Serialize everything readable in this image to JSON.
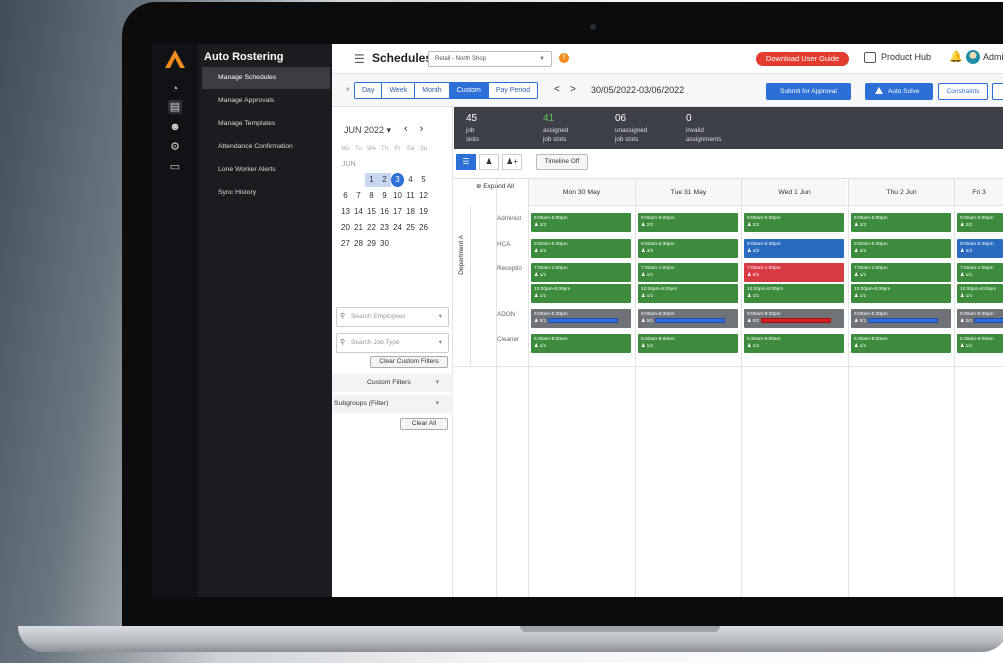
{
  "nav": {
    "title": "Auto Rostering",
    "items": [
      {
        "label": "Manage Schedules",
        "active": true
      },
      {
        "label": "Manage Approvals",
        "active": false
      },
      {
        "label": "Manage Templates",
        "active": false
      },
      {
        "label": "Attendance Confirmation",
        "active": false
      },
      {
        "label": "Lone Worker Alerts",
        "active": false
      },
      {
        "label": "Sync History",
        "active": false
      }
    ]
  },
  "rail": {
    "icons": [
      "gauge-icon",
      "calendar-icon",
      "users-icon",
      "gear-icon",
      "folder-icon"
    ]
  },
  "header": {
    "title": "Schedules",
    "shop_select": "Retail - North Shop",
    "guide_button": "Download User Guide",
    "product_hub": "Product Hub",
    "user_label": "Admin"
  },
  "toolbar": {
    "collapse": "«",
    "views": [
      {
        "label": "Day",
        "active": false
      },
      {
        "label": "Week",
        "active": false
      },
      {
        "label": "Month",
        "active": false
      },
      {
        "label": "Custom",
        "active": true
      },
      {
        "label": "Pay Period",
        "active": false
      }
    ],
    "prev": "<",
    "next": ">",
    "range": "30/05/2022-03/06/2022",
    "submit": "Submit for Approval",
    "auto_solve": "Auto Solve",
    "constraints": "Constraints"
  },
  "calendar": {
    "month": "JUN 2022",
    "dow": [
      "Mo",
      "Tu",
      "We",
      "Th",
      "Fr",
      "Sa",
      "Su"
    ],
    "sub_label": "JUN",
    "weeks": [
      [
        "",
        "",
        "1",
        "2",
        "3",
        "4",
        "5"
      ],
      [
        "6",
        "7",
        "8",
        "9",
        "10",
        "11",
        "12"
      ],
      [
        "13",
        "14",
        "15",
        "16",
        "17",
        "18",
        "19"
      ],
      [
        "20",
        "21",
        "22",
        "23",
        "24",
        "25",
        "26"
      ],
      [
        "27",
        "28",
        "29",
        "30",
        "",
        "",
        ""
      ]
    ]
  },
  "filters": {
    "employees_placeholder": "Search Employees",
    "jobtype_placeholder": "Search Job Type",
    "clear_custom": "Clear Custom Filters",
    "custom_filters": "Custom Filters",
    "subgroups": "Subgroups (Filter)",
    "clear_all": "Clear All"
  },
  "stats": [
    {
      "num": "45",
      "lines": [
        "job",
        "slots"
      ]
    },
    {
      "num": "41",
      "lines": [
        "assigned",
        "job slots"
      ]
    },
    {
      "num": "06",
      "lines": [
        "unassigned",
        "job slots"
      ]
    },
    {
      "num": "0",
      "lines": [
        "invalid",
        "assignments"
      ]
    }
  ],
  "grid_controls": {
    "timeline": "Timeline Off"
  },
  "grid": {
    "expand_all": "Expand All",
    "department": "Department A",
    "days": [
      "Mon 30 May",
      "Tue 31 May",
      "Wed 1 Jun",
      "Thu 2 Jun",
      "Fri 3"
    ],
    "rows": [
      {
        "role": "Administ",
        "shifts": [
          {
            "time": "9:00am-5:00pm",
            "count": "2/2",
            "color": "green"
          },
          {
            "time": "9:00am-5:00pm",
            "count": "2/2",
            "color": "green"
          },
          {
            "time": "9:00am-5:00pm",
            "count": "2/2",
            "color": "green"
          },
          {
            "time": "9:00am-5:00pm",
            "count": "2/2",
            "color": "green"
          },
          {
            "time": "9:00am-5:00pm",
            "count": "2/2",
            "color": "green"
          }
        ]
      },
      {
        "role": "HCA",
        "shifts": [
          {
            "time": "9:00am-5:30pm",
            "count": "3/3",
            "color": "green"
          },
          {
            "time": "9:00am-5:30pm",
            "count": "3/3",
            "color": "green"
          },
          {
            "time": "9:00am-5:30pm",
            "count": "4/3",
            "color": "blue"
          },
          {
            "time": "9:00am-5:30pm",
            "count": "3/3",
            "color": "green"
          },
          {
            "time": "9:00am-5:30pm",
            "count": "4/3",
            "color": "blue"
          }
        ]
      },
      {
        "role": "Receptio",
        "shifts": [
          {
            "time": "7:00am-1:00pm",
            "count": "1/1",
            "color": "green"
          },
          {
            "time": "7:00am-1:00pm",
            "count": "1/1",
            "color": "green"
          },
          {
            "time": "7:00am-1:00pm",
            "count": "0/1",
            "color": "red"
          },
          {
            "time": "7:00am-1:00pm",
            "count": "1/1",
            "color": "green"
          },
          {
            "time": "7:00am-1:00pm",
            "count": "1/1",
            "color": "green"
          }
        ]
      },
      {
        "role": "",
        "shifts": [
          {
            "time": "12:00pm-8:00pm",
            "count": "1/1",
            "color": "green"
          },
          {
            "time": "12:00pm-8:00pm",
            "count": "1/1",
            "color": "green"
          },
          {
            "time": "12:00pm-8:00pm",
            "count": "1/1",
            "color": "green"
          },
          {
            "time": "12:00pm-8:00pm",
            "count": "1/1",
            "color": "green"
          },
          {
            "time": "12:00pm-8:00pm",
            "count": "1/1",
            "color": "green"
          }
        ]
      },
      {
        "role": "ADON",
        "shifts": [
          {
            "time": "9:00am-5:30pm",
            "count": "0/1",
            "color": "grey",
            "bar": "blue"
          },
          {
            "time": "9:00am-5:30pm",
            "count": "0/1",
            "color": "grey",
            "bar": "blue"
          },
          {
            "time": "9:00am-8:30pm",
            "count": "0/1",
            "color": "grey",
            "bar": "red"
          },
          {
            "time": "9:00am-5:30pm",
            "count": "0/1",
            "color": "grey",
            "bar": "blue"
          },
          {
            "time": "9:00am-5:30pm",
            "count": "0/1",
            "color": "grey",
            "bar": "blue"
          }
        ]
      },
      {
        "role": "Cleaner",
        "shifts": [
          {
            "time": "5:30am-8:00am",
            "count": "1/1",
            "color": "green"
          },
          {
            "time": "5:30am-8:00am",
            "count": "1/1",
            "color": "green"
          },
          {
            "time": "5:30am-8:00am",
            "count": "1/1",
            "color": "green"
          },
          {
            "time": "5:30am-8:00am",
            "count": "1/1",
            "color": "green"
          },
          {
            "time": "5:30am-8:00am",
            "count": "1/1",
            "color": "green"
          }
        ]
      }
    ]
  }
}
